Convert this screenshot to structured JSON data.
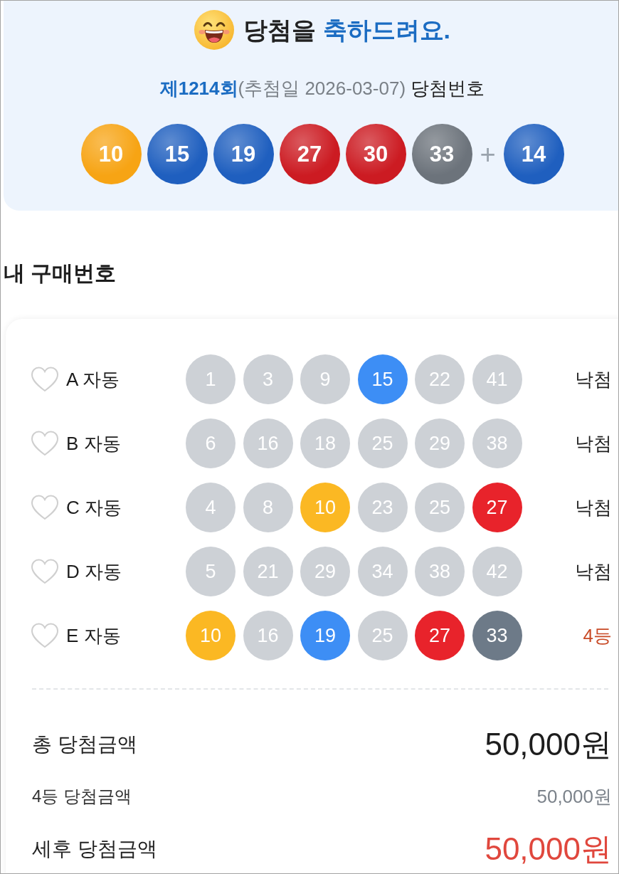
{
  "header": {
    "title": [
      {
        "text": "당첨을",
        "highlight": false
      },
      {
        "text": "축하드려요.",
        "highlight": true
      }
    ],
    "draw_info": [
      {
        "kind": "round",
        "text": "제1214회"
      },
      {
        "kind": "date",
        "text": "(추첨일 2026-03-07)"
      },
      {
        "kind": "label",
        "text": "당첨번호"
      }
    ],
    "winning_numbers": [
      {
        "number": "10",
        "color": "#f7a414"
      },
      {
        "number": "15",
        "color": "#1f5fbf"
      },
      {
        "number": "19",
        "color": "#1f5fbf"
      },
      {
        "number": "27",
        "color": "#cc1b22"
      },
      {
        "number": "30",
        "color": "#cc1b22"
      },
      {
        "number": "33",
        "color": "#6c737b"
      }
    ],
    "bonus_separator": "+",
    "bonus_number": {
      "number": "14",
      "color": "#1f5fbf"
    }
  },
  "section_title": "내 구매번호",
  "tickets": [
    {
      "label": "A 자동",
      "favorite": false,
      "numbers": [
        {
          "number": "1",
          "color": "#cdd1d6"
        },
        {
          "number": "3",
          "color": "#cdd1d6"
        },
        {
          "number": "9",
          "color": "#cdd1d6"
        },
        {
          "number": "15",
          "color": "#3d8ef5"
        },
        {
          "number": "22",
          "color": "#cdd1d6"
        },
        {
          "number": "41",
          "color": "#cdd1d6"
        }
      ],
      "result": "낙첨",
      "won": false
    },
    {
      "label": "B 자동",
      "favorite": false,
      "numbers": [
        {
          "number": "6",
          "color": "#cdd1d6"
        },
        {
          "number": "16",
          "color": "#cdd1d6"
        },
        {
          "number": "18",
          "color": "#cdd1d6"
        },
        {
          "number": "25",
          "color": "#cdd1d6"
        },
        {
          "number": "29",
          "color": "#cdd1d6"
        },
        {
          "number": "38",
          "color": "#cdd1d6"
        }
      ],
      "result": "낙첨",
      "won": false
    },
    {
      "label": "C 자동",
      "favorite": false,
      "numbers": [
        {
          "number": "4",
          "color": "#cdd1d6"
        },
        {
          "number": "8",
          "color": "#cdd1d6"
        },
        {
          "number": "10",
          "color": "#fbb823"
        },
        {
          "number": "23",
          "color": "#cdd1d6"
        },
        {
          "number": "25",
          "color": "#cdd1d6"
        },
        {
          "number": "27",
          "color": "#e8232b"
        }
      ],
      "result": "낙첨",
      "won": false
    },
    {
      "label": "D 자동",
      "favorite": false,
      "numbers": [
        {
          "number": "5",
          "color": "#cdd1d6"
        },
        {
          "number": "21",
          "color": "#cdd1d6"
        },
        {
          "number": "29",
          "color": "#cdd1d6"
        },
        {
          "number": "34",
          "color": "#cdd1d6"
        },
        {
          "number": "38",
          "color": "#cdd1d6"
        },
        {
          "number": "42",
          "color": "#cdd1d6"
        }
      ],
      "result": "낙첨",
      "won": false
    },
    {
      "label": "E 자동",
      "favorite": false,
      "numbers": [
        {
          "number": "10",
          "color": "#fbb823"
        },
        {
          "number": "16",
          "color": "#cdd1d6"
        },
        {
          "number": "19",
          "color": "#3d8ef5"
        },
        {
          "number": "25",
          "color": "#cdd1d6"
        },
        {
          "number": "27",
          "color": "#e8232b"
        },
        {
          "number": "33",
          "color": "#6d7a88"
        }
      ],
      "result": "4등",
      "won": true
    }
  ],
  "summary": [
    {
      "kind": "total",
      "label": "총 당첨금액",
      "amount": "50,000원"
    },
    {
      "kind": "rank",
      "label": "4등 당첨금액",
      "amount": "50,000원"
    },
    {
      "kind": "after_tax",
      "label": "세후 당첨금액",
      "amount": "50,000원"
    }
  ]
}
